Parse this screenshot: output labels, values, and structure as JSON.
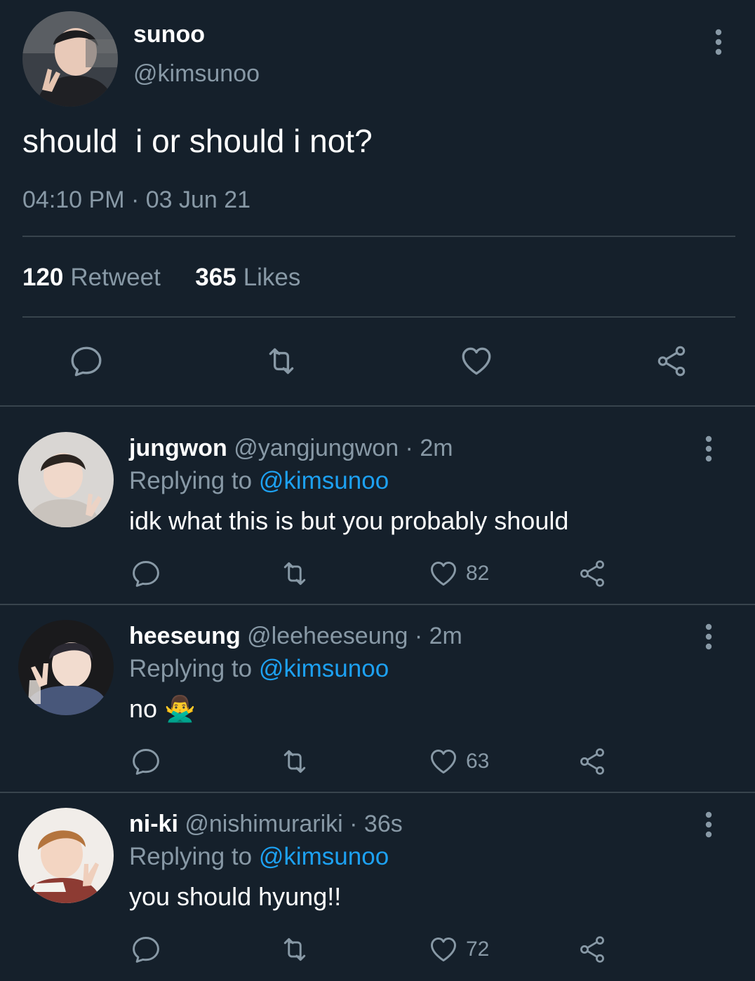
{
  "main_tweet": {
    "name": "sunoo",
    "handle": "@kimsunoo",
    "text": "should  i or should i not?",
    "timestamp": "04:10 PM · 03 Jun 21",
    "retweet_count": "120",
    "retweet_label": "Retweet",
    "likes_count": "365",
    "likes_label": "Likes"
  },
  "replies": [
    {
      "name": "jungwon",
      "meta": "@yangjungwon · 2m",
      "replying_label": "Replying to",
      "replying_to": "@kimsunoo",
      "text": "idk what this is but you probably should",
      "likes": "82"
    },
    {
      "name": "heeseung",
      "meta": "@leeheeseung · 2m",
      "replying_label": "Replying to",
      "replying_to": "@kimsunoo",
      "text": "no 🙅‍♂️",
      "likes": "63"
    },
    {
      "name": "ni-ki",
      "meta": "@nishimurariki · 36s",
      "replying_label": "Replying to",
      "replying_to": "@kimsunoo",
      "text": "you should hyung!!",
      "likes": "72"
    }
  ],
  "icons": {
    "reply": "comment-icon",
    "retweet": "retweet-icon",
    "like": "heart-icon",
    "share": "share-icon",
    "more": "more-vertical-icon"
  },
  "colors": {
    "background": "#15202b",
    "divider": "#38444d",
    "muted_text": "#8899a6",
    "link": "#1da1f2"
  }
}
